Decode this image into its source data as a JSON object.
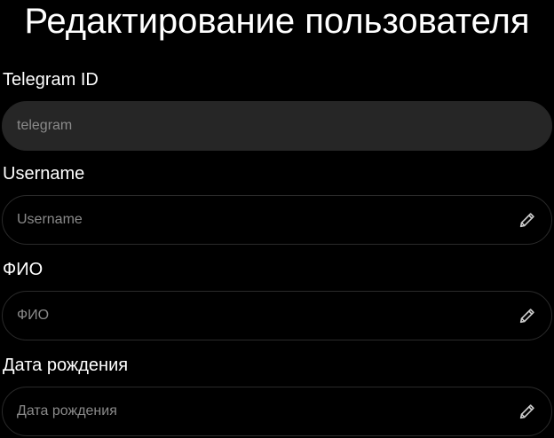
{
  "page": {
    "title": "Редактирование пользователя"
  },
  "form": {
    "telegram_id": {
      "label": "Telegram ID",
      "placeholder": "telegram",
      "value": ""
    },
    "username": {
      "label": "Username",
      "placeholder": "Username",
      "value": "",
      "icon": "pencil-icon"
    },
    "fio": {
      "label": "ФИО",
      "placeholder": "ФИО",
      "value": "",
      "icon": "pencil-icon"
    },
    "birth_date": {
      "label": "Дата рождения",
      "placeholder": "Дата рождения",
      "value": "",
      "icon": "pencil-icon"
    }
  },
  "colors": {
    "background": "#000000",
    "readonly_field": "#262626",
    "field_border": "#2a2a2a",
    "placeholder": "#8a8a8a",
    "icon": "#cccccc"
  }
}
